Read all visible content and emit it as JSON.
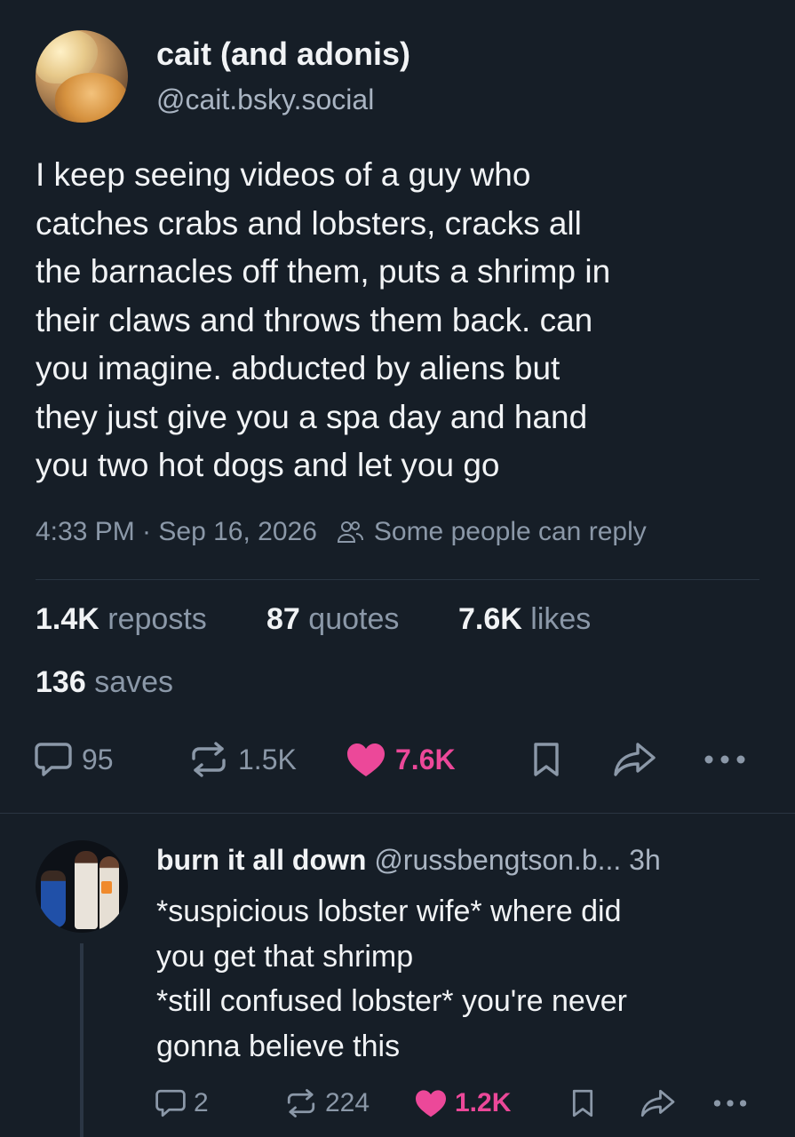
{
  "post": {
    "display_name": "cait (and adonis)",
    "handle": "@cait.bsky.social",
    "text_lines": [
      "I keep seeing videos of a guy who",
      "catches crabs and lobsters, cracks all",
      "the barnacles off them, puts a shrimp in",
      "their claws and throws them back. can",
      "you imagine. abducted by aliens but",
      "they just give you a spa day and hand",
      "you two hot dogs and let you go"
    ],
    "timestamp": "4:33 PM · Sep 16, 2026",
    "reply_setting": "Some people can reply",
    "stats": {
      "reposts_count": "1.4K",
      "reposts_label": "reposts",
      "quotes_count": "87",
      "quotes_label": "quotes",
      "likes_count": "7.6K",
      "likes_label": "likes",
      "saves_count": "136",
      "saves_label": "saves"
    },
    "actions": {
      "replies": "95",
      "reposts": "1.5K",
      "likes": "7.6K"
    }
  },
  "reply": {
    "display_name": "burn it all down",
    "handle": "@russbengtson.b...",
    "time": "3h",
    "text_lines": [
      "*suspicious lobster wife* where did",
      "you get that shrimp",
      "*still confused lobster* you're never",
      "gonna believe this"
    ],
    "actions": {
      "replies": "2",
      "reposts": "224",
      "likes": "1.2K"
    }
  },
  "colors": {
    "background": "#161e27",
    "text": "#f1f3f5",
    "muted": "#8b98a8",
    "like": "#ec4899"
  },
  "icons": [
    "reply-icon",
    "repost-icon",
    "heart-icon",
    "bookmark-icon",
    "share-icon",
    "more-icon",
    "people-icon"
  ]
}
